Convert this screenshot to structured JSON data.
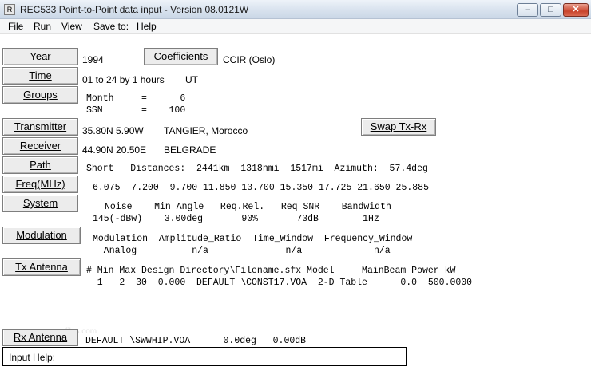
{
  "window": {
    "title": "REC533 Point-to-Point data input - Version 08.0121W"
  },
  "menu": [
    "File",
    "Run",
    "View",
    "Save to:",
    "Help"
  ],
  "buttons": {
    "year": "Year",
    "time": "Time",
    "groups": "Groups",
    "coefficients": "Coefficients",
    "transmitter": "Transmitter",
    "receiver": "Receiver",
    "path": "Path",
    "freq": "Freq(MHz)",
    "system": "System",
    "modulation": "Modulation",
    "tx_antenna": "Tx Antenna",
    "swap": "Swap Tx-Rx",
    "rx_antenna": "Rx Antenna"
  },
  "year": {
    "value": "1994",
    "coefficients_model": "CCIR (Oslo)"
  },
  "time": {
    "range": "01 to 24 by  1 hours",
    "zone": "UT"
  },
  "groups": {
    "month_line": "Month     =      6",
    "ssn_line": "SSN       =    100"
  },
  "transmitter": {
    "coords": "35.80N   5.90W",
    "name": "TANGIER, Morocco"
  },
  "receiver": {
    "coords": "44.90N  20.50E",
    "name": "BELGRADE"
  },
  "path": {
    "line": "Short   Distances:  2441km  1318nmi  1517mi  Azimuth:  57.4deg"
  },
  "freq": {
    "line": "6.075  7.200  9.700 11.850 13.700 15.350 17.725 21.650 25.885"
  },
  "system": {
    "header": "Noise    Min Angle   Req.Rel.   Req SNR    Bandwidth",
    "values": "145(-dBw)    3.00deg       90%       73dB        1Hz"
  },
  "modulation": {
    "header": "Modulation  Amplitude_Ratio  Time_Window  Frequency_Window",
    "values": "  Analog          n/a              n/a             n/a"
  },
  "tx_antenna": {
    "header": "# Min Max Design Directory\\Filename.sfx Model     MainBeam Power kW",
    "row": "  1   2  30  0.000  DEFAULT \\CONST17.VOA  2-D Table      0.0  500.0000"
  },
  "rx_antenna": {
    "line": "DEFAULT \\SWWHIP.VOA      0.0deg   0.00dB"
  },
  "input_help": {
    "label": "Input Help:"
  },
  "watermark": "snapfiles.com"
}
